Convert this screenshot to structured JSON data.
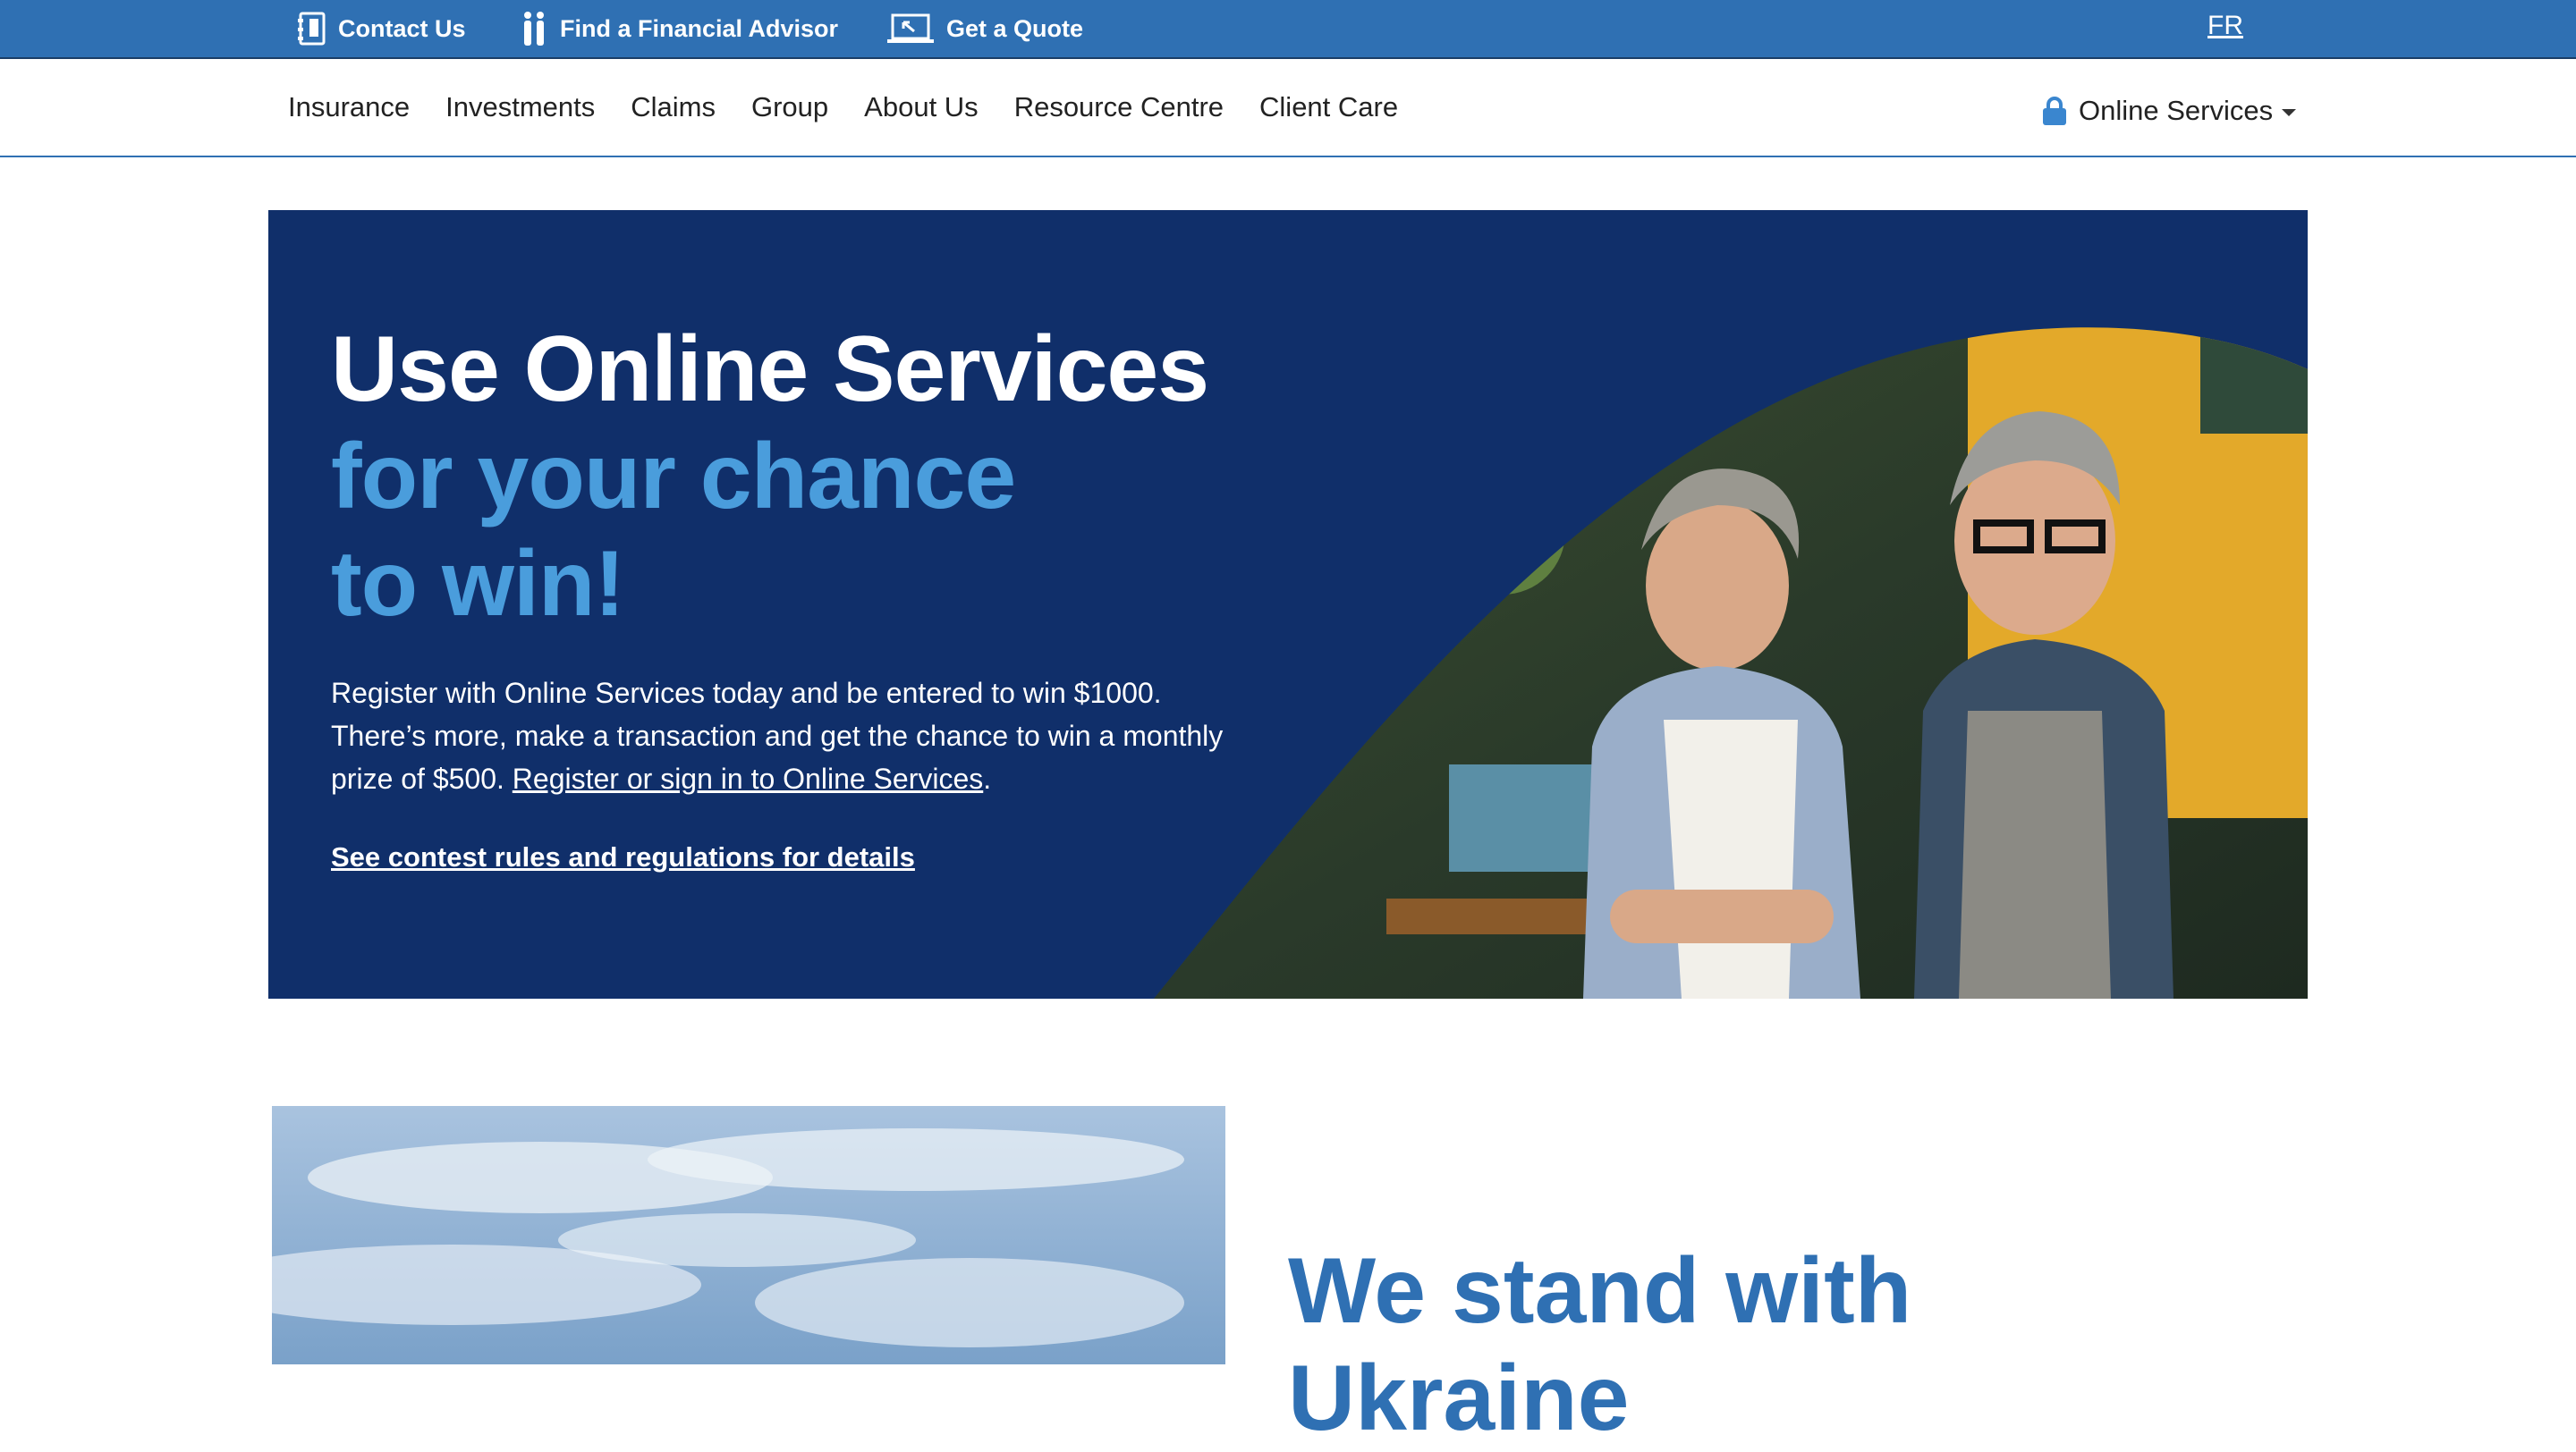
{
  "utility_bar": {
    "contact_us": "Contact Us",
    "find_advisor": "Find a Financial Advisor",
    "get_quote": "Get a Quote",
    "language": "FR"
  },
  "nav": {
    "items": [
      "Insurance",
      "Investments",
      "Claims",
      "Group",
      "About Us",
      "Resource Centre",
      "Client Care"
    ],
    "online_services": "Online Services"
  },
  "hero": {
    "title_line1": "Use Online Services",
    "title_line2": "for your chance",
    "title_line3": "to win!",
    "body_text": "Register with Online Services today and be entered to win $1000. There’s more, make a transaction and get the chance to win a monthly prize of $500. ",
    "body_link": "Register or sign in to Online Services",
    "body_end": ".",
    "rules_link": "See contest rules and regulations for details"
  },
  "section": {
    "title": "We stand with\nUkraine"
  },
  "colors": {
    "brand_blue": "#2f70b3",
    "hero_navy": "#102f6a",
    "accent_light_blue": "#4a9ddc"
  }
}
